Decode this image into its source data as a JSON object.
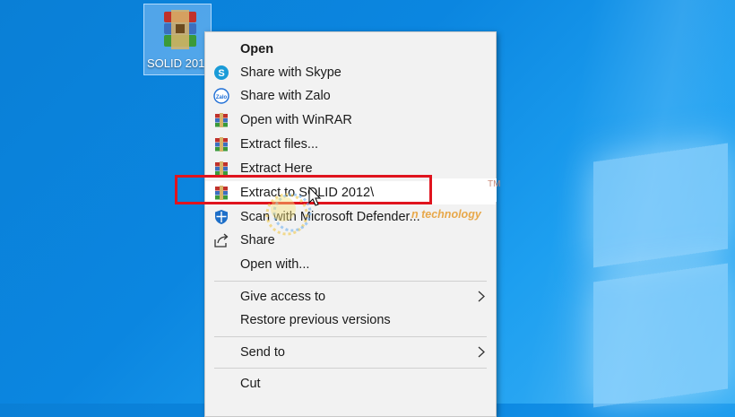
{
  "desktop": {
    "icon_label": "SOLID 201",
    "icon": "winrar-archive-icon"
  },
  "menu": {
    "items": [
      {
        "label": "Open",
        "icon": null,
        "bold": true
      },
      {
        "label": "Share with Skype",
        "icon": "skype-icon"
      },
      {
        "label": "Share with Zalo",
        "icon": "zalo-icon"
      },
      {
        "label": "Open with WinRAR",
        "icon": "winrar-icon"
      },
      {
        "label": "Extract files...",
        "icon": "winrar-icon"
      },
      {
        "label": "Extract Here",
        "icon": "winrar-icon"
      },
      {
        "label": "Extract to SOLID 2012\\",
        "icon": "winrar-icon",
        "hovered": true
      },
      {
        "label": "Scan with Microsoft Defender...",
        "icon": "defender-shield-icon"
      },
      {
        "label": "Share",
        "icon": "share-icon"
      },
      {
        "label": "Open with...",
        "icon": null
      },
      {
        "label": "Give access to",
        "icon": null,
        "submenu": true
      },
      {
        "label": "Restore previous versions",
        "icon": null
      },
      {
        "label": "Send to",
        "icon": null,
        "submenu": true
      },
      {
        "label": "Cut",
        "icon": null
      }
    ]
  },
  "overlay": {
    "watermark_text": "n technology",
    "trademark": "TM",
    "highlight_color": "#e0141e"
  },
  "colors": {
    "desktop_bg": "#0b86e0",
    "menu_bg": "#f2f2f2",
    "hover_bg": "#ffffff"
  }
}
